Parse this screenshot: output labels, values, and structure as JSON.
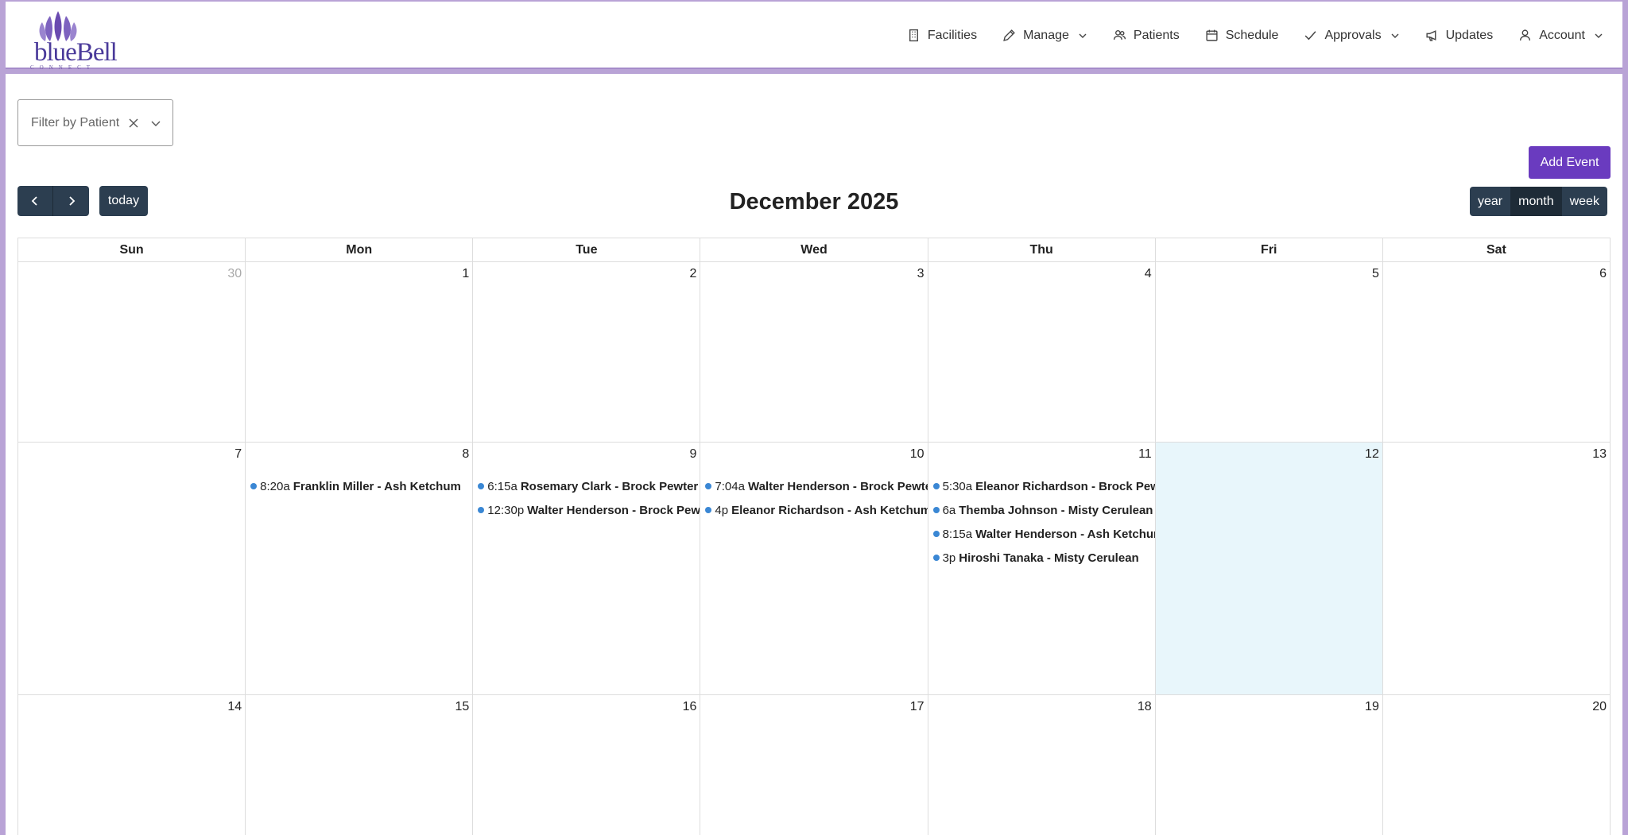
{
  "app": {
    "logo_text": "blueBell",
    "logo_sub": "CONNECT"
  },
  "nav": [
    {
      "label": "Facilities",
      "icon": "building-icon"
    },
    {
      "label": "Manage",
      "icon": "pencil-icon",
      "dropdown": true
    },
    {
      "label": "Patients",
      "icon": "users-icon"
    },
    {
      "label": "Schedule",
      "icon": "calendar-icon"
    },
    {
      "label": "Approvals",
      "icon": "check-icon",
      "dropdown": true
    },
    {
      "label": "Updates",
      "icon": "megaphone-icon"
    },
    {
      "label": "Account",
      "icon": "user-icon",
      "dropdown": true
    }
  ],
  "filter": {
    "placeholder": "Filter by Patient"
  },
  "toolbar": {
    "add_event": "Add Event",
    "today": "today",
    "title": "December 2025",
    "views": [
      "year",
      "month",
      "week"
    ],
    "active_view": "month"
  },
  "colors": {
    "accent": "#6a3bbf",
    "button": "#2c3e50",
    "event_dot": "#3a87d4",
    "today_bg": "#e8f6fb"
  },
  "calendar": {
    "days_of_week": [
      "Sun",
      "Mon",
      "Tue",
      "Wed",
      "Thu",
      "Fri",
      "Sat"
    ],
    "weeks": [
      [
        {
          "day": "30",
          "other": true,
          "events": []
        },
        {
          "day": "1",
          "events": []
        },
        {
          "day": "2",
          "events": []
        },
        {
          "day": "3",
          "events": []
        },
        {
          "day": "4",
          "events": []
        },
        {
          "day": "5",
          "events": []
        },
        {
          "day": "6",
          "events": []
        }
      ],
      [
        {
          "day": "7",
          "events": []
        },
        {
          "day": "8",
          "events": [
            {
              "time": "8:20a",
              "title": "Franklin Miller - Ash Ketchum"
            }
          ]
        },
        {
          "day": "9",
          "events": [
            {
              "time": "6:15a",
              "title": "Rosemary Clark - Brock Pewter"
            },
            {
              "time": "12:30p",
              "title": "Walter Henderson - Brock Pewter"
            }
          ]
        },
        {
          "day": "10",
          "events": [
            {
              "time": "7:04a",
              "title": "Walter Henderson - Brock Pewter"
            },
            {
              "time": "4p",
              "title": "Eleanor Richardson - Ash Ketchum"
            }
          ]
        },
        {
          "day": "11",
          "events": [
            {
              "time": "5:30a",
              "title": "Eleanor Richardson - Brock Pewter"
            },
            {
              "time": "6a",
              "title": "Themba Johnson - Misty Cerulean"
            },
            {
              "time": "8:15a",
              "title": "Walter Henderson - Ash Ketchum"
            },
            {
              "time": "3p",
              "title": "Hiroshi Tanaka - Misty Cerulean"
            }
          ]
        },
        {
          "day": "12",
          "today": true,
          "events": []
        },
        {
          "day": "13",
          "events": []
        }
      ],
      [
        {
          "day": "14",
          "events": []
        },
        {
          "day": "15",
          "events": []
        },
        {
          "day": "16",
          "events": []
        },
        {
          "day": "17",
          "events": []
        },
        {
          "day": "18",
          "events": []
        },
        {
          "day": "19",
          "events": []
        },
        {
          "day": "20",
          "events": []
        }
      ]
    ]
  }
}
